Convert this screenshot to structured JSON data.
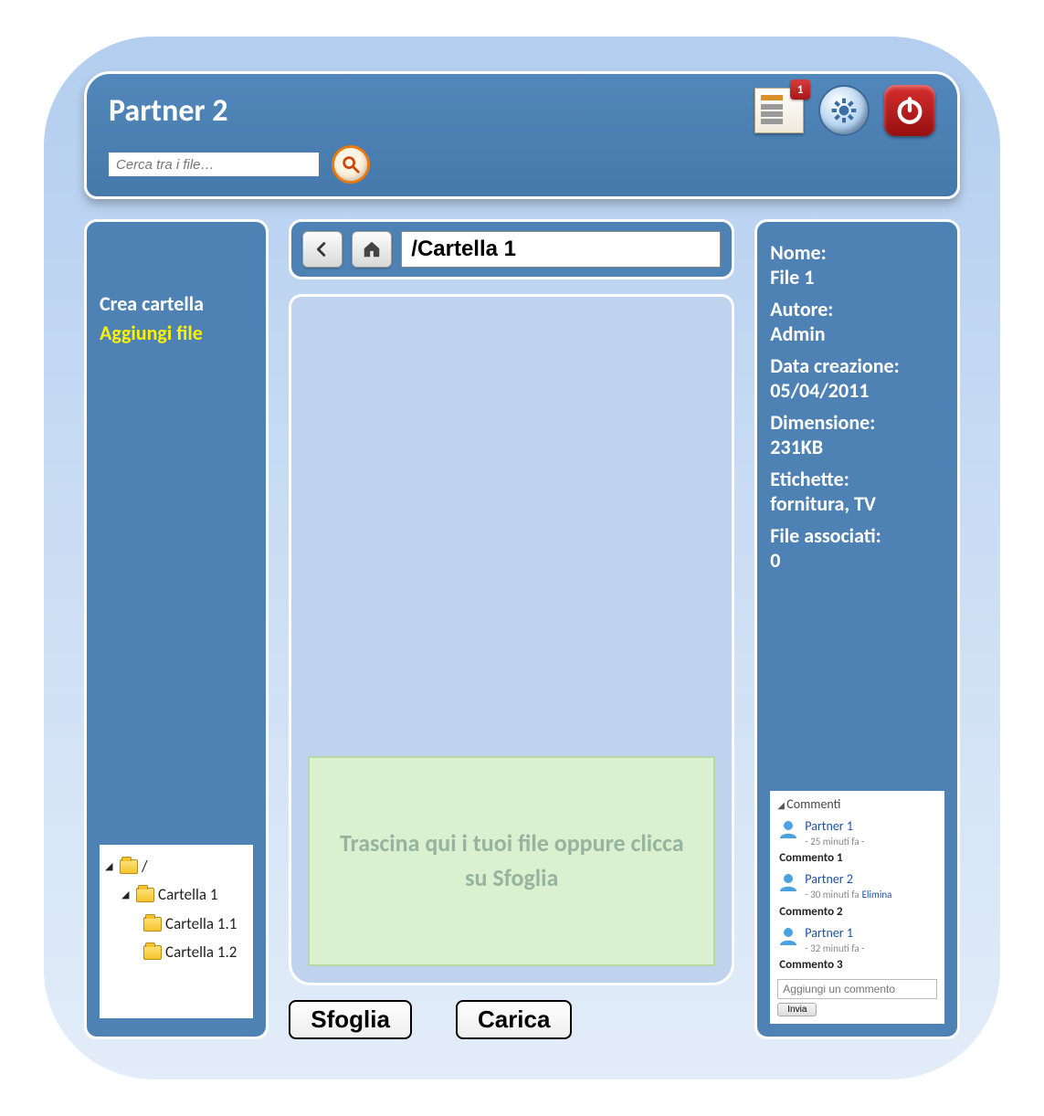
{
  "header": {
    "title": "Partner 2",
    "search_placeholder": "Cerca tra i file…",
    "notification_count": "1"
  },
  "sidebar": {
    "create_folder_label": "Crea cartella",
    "add_file_label": "Aggiungi file",
    "tree": {
      "root_label": "/",
      "folder1": "Cartella 1",
      "folder1_1": "Cartella 1.1",
      "folder1_2": "Cartella 1.2"
    }
  },
  "path": {
    "value": "/Cartella 1"
  },
  "dropzone": {
    "text": "Trascina qui i tuoi file oppure clicca su Sfoglia"
  },
  "actions": {
    "browse": "Sfoglia",
    "upload": "Carica"
  },
  "details": {
    "name_label": "Nome:",
    "name_value": "File 1",
    "author_label": "Autore:",
    "author_value": "Admin",
    "created_label": "Data creazione:",
    "created_value": "05/04/2011",
    "size_label": "Dimensione:",
    "size_value": "231KB",
    "tags_label": "Etichette:",
    "tags_value": "fornitura, TV",
    "linked_label": "File associati:",
    "linked_value": "0"
  },
  "comments": {
    "title": "Commenti",
    "items": [
      {
        "author": "Partner 1",
        "meta": "- 25 minuti fa -",
        "text": "Commento 1",
        "deletable": false
      },
      {
        "author": "Partner 2",
        "meta": "- 30 minuti fa",
        "text": "Commento 2",
        "deletable": true
      },
      {
        "author": "Partner 1",
        "meta": "- 32 minuti fa -",
        "text": "Commento 3",
        "deletable": false
      }
    ],
    "delete_label": "Elimina",
    "add_placeholder": "Aggiungi un commento",
    "send_label": "Invia"
  }
}
